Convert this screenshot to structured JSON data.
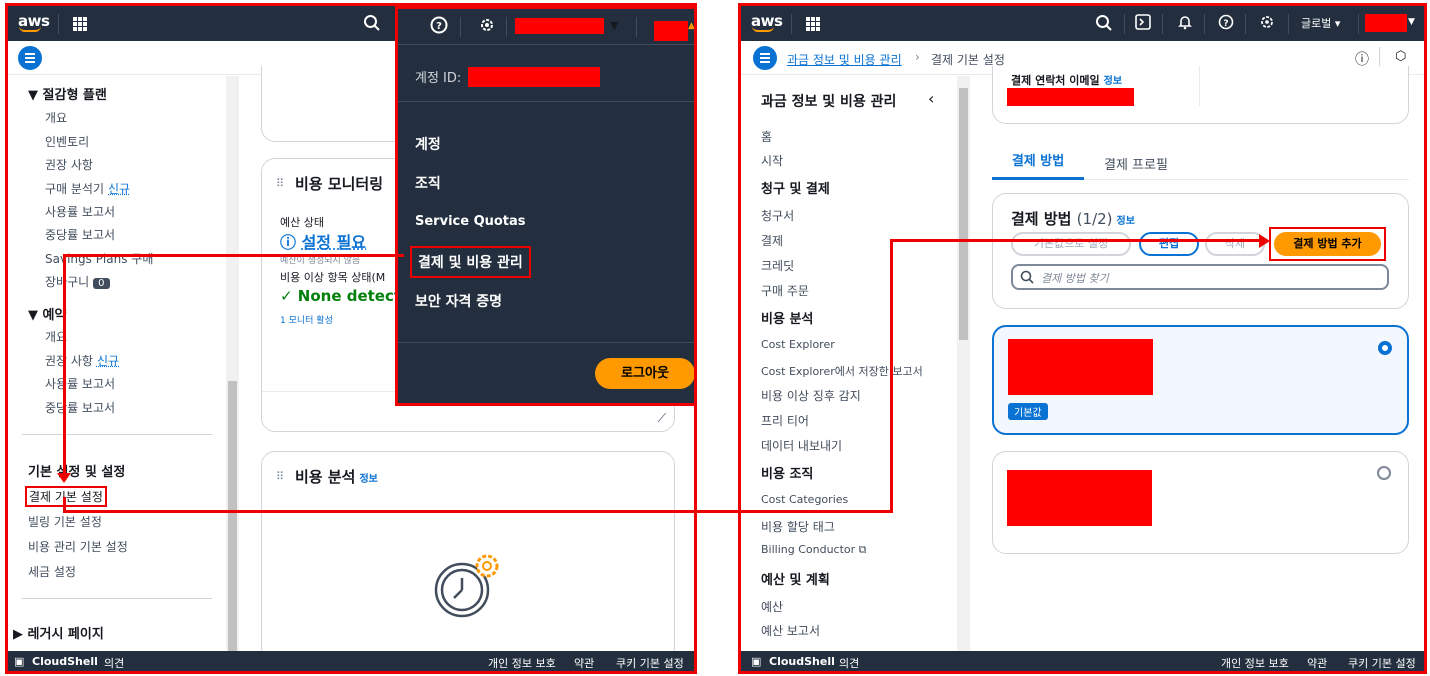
{
  "left": {
    "topbar": {
      "logo": "aws"
    },
    "sidebar": {
      "savings_plans_header": "▼ 절감형 플랜",
      "savings_items": [
        "개요",
        "인벤토리",
        "권장 사항",
        "구매 분석기",
        "사용률 보고서",
        "중당률 보고서",
        "Savings Plans 구매",
        "장바구니"
      ],
      "new_tag": "신규",
      "cart_count": "0",
      "reservations_header": "▼ 예약",
      "reservation_items": [
        "개요",
        "권장 사항",
        "사용률 보고서",
        "중당률 보고서"
      ],
      "prefs_header": "기본 설정 및 설정",
      "prefs_items": [
        "결제 기본 설정",
        "빌링 기본 설정",
        "비용 관리 기본 설정",
        "세금 설정"
      ],
      "legacy_header": "▶ 레거시 페이지"
    },
    "cost_monitor": {
      "title": "비용 모니터링",
      "budget_status_label": "예산 상태",
      "budget_status_value": "설정 필요",
      "budget_hint": "예산이 생성되지 않음",
      "anomaly_label": "비용 이상 항목 상태(M",
      "anomaly_value": "None detect",
      "monitor_link": "1 모니터 활성"
    },
    "cost_analysis": {
      "title": "비용 분석",
      "info": "정보"
    },
    "dropdown": {
      "account_id_label": "계정 ID:",
      "items": [
        "계정",
        "조직",
        "Service Quotas",
        "결제 및 비용 관리",
        "보안 자격 증명"
      ],
      "logout": "로그아웃"
    },
    "footer": {
      "cloudshell": "CloudShell",
      "feedback": "의견",
      "privacy": "개인 정보 보호",
      "terms": "약관",
      "cookies": "쿠키 기본 설정"
    }
  },
  "right": {
    "topbar": {
      "logo": "aws",
      "region": "글로벌 ▾"
    },
    "breadcrumb": {
      "parent": "과금 정보 및 비용 관리",
      "current": "결제 기본 설정"
    },
    "sidebar": {
      "title": "과금 정보 및 비용 관리",
      "items_top": [
        "홈",
        "시작"
      ],
      "billing_header": "청구 및 결제",
      "billing_items": [
        "청구서",
        "결제",
        "크레딧",
        "구매 주문"
      ],
      "analysis_header": "비용 분석",
      "analysis_items": [
        "Cost Explorer",
        "Cost Explorer에서 저장한 보고서",
        "비용 이상 징후 감지",
        "프리 티어",
        "데이터 내보내기"
      ],
      "org_header": "비용 조직",
      "org_items": [
        "Cost Categories",
        "비용 할당 태그",
        "Billing Conductor"
      ],
      "budget_header": "예산 및 계획",
      "budget_items": [
        "예산",
        "예산 보고서"
      ]
    },
    "contact": {
      "label": "결제 연락처 이메일",
      "info": "정보"
    },
    "tabs": [
      "결제 방법",
      "결제 프로필"
    ],
    "methods": {
      "title": "결제 방법",
      "count": "(1/2)",
      "info": "정보",
      "btn_default": "기본값으로 설정",
      "btn_edit": "편집",
      "btn_delete": "삭제",
      "btn_add": "결제 방법 추가",
      "search_placeholder": "결제 방법 찾기",
      "default_badge": "기본값"
    },
    "footer": {
      "cloudshell": "CloudShell",
      "feedback": "의견",
      "privacy": "개인 정보 보호",
      "terms": "약관",
      "cookies": "쿠키 기본 설정"
    }
  },
  "colors": {
    "accent": "#0972d3",
    "highlight": "#e00000",
    "orange": "#ff9900",
    "navbar": "#232f3e",
    "success": "#037f0c"
  }
}
